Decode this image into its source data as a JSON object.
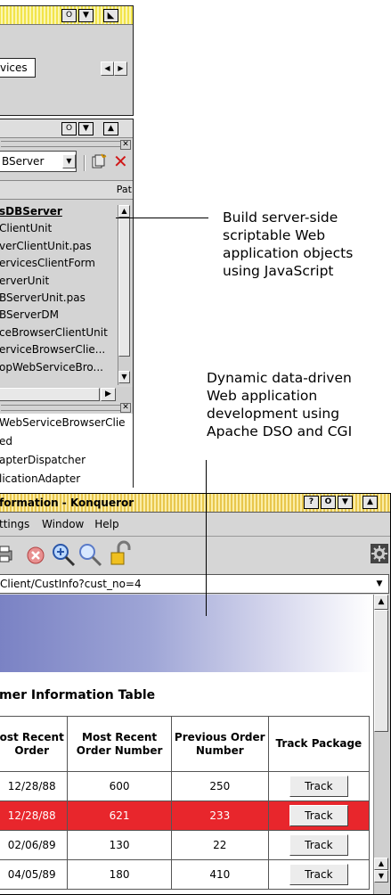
{
  "window1": {
    "tab_label": "vices",
    "title_buttons": [
      "O",
      "▼",
      "▲"
    ]
  },
  "window2": {
    "combo_value": "BServer",
    "column_header": "Pat",
    "tree_items": [
      {
        "label": "sDBServer",
        "selected": true
      },
      {
        "label": "ClientUnit",
        "selected": false
      },
      {
        "label": "verClientUnit.pas",
        "selected": false
      },
      {
        "label": "ervicesClientForm",
        "selected": false
      },
      {
        "label": "erverUnit",
        "selected": false
      },
      {
        "label": "BServerUnit.pas",
        "selected": false
      },
      {
        "label": "BServerDM",
        "selected": false
      },
      {
        "label": "ceBrowserClientUnit",
        "selected": false
      },
      {
        "label": "erviceBrowserClie...",
        "selected": false
      },
      {
        "label": "opWebServiceBro...",
        "selected": false
      }
    ],
    "list_items": [
      "WebServiceBrowserClie",
      "ed",
      "apterDispatcher",
      "licationAdapter"
    ]
  },
  "konqueror": {
    "title": "formation - Konqueror",
    "title_buttons": [
      "?",
      "O",
      "▼",
      "▲"
    ],
    "menu": [
      "ttings",
      "Window",
      "Help"
    ],
    "url": "Client/CustInfo?cust_no=4",
    "page_heading": "mer Information Table",
    "table": {
      "headers": [
        "ost Recent Order",
        "Most Recent Order Number",
        "Previous Order Number",
        "Track Package"
      ],
      "rows": [
        {
          "date": "12/28/88",
          "recent_no": "600",
          "prev_no": "250",
          "button": "Track",
          "highlight": false
        },
        {
          "date": "12/28/88",
          "recent_no": "621",
          "prev_no": "233",
          "button": "Track",
          "highlight": true
        },
        {
          "date": "02/06/89",
          "recent_no": "130",
          "prev_no": "22",
          "button": "Track",
          "highlight": false
        },
        {
          "date": "04/05/89",
          "recent_no": "180",
          "prev_no": "410",
          "button": "Track",
          "highlight": false
        }
      ]
    }
  },
  "callouts": {
    "c1": [
      "Build server-side",
      "scriptable Web",
      "application objects",
      "using JavaScript"
    ],
    "c2": [
      "Dynamic data-driven",
      "Web application",
      "development using",
      "Apache DSO and CGI"
    ]
  },
  "colors": {
    "highlight_row": "#e8262c",
    "banner_start": "#7a82c4",
    "konqueror_title": "#e8c74d"
  }
}
